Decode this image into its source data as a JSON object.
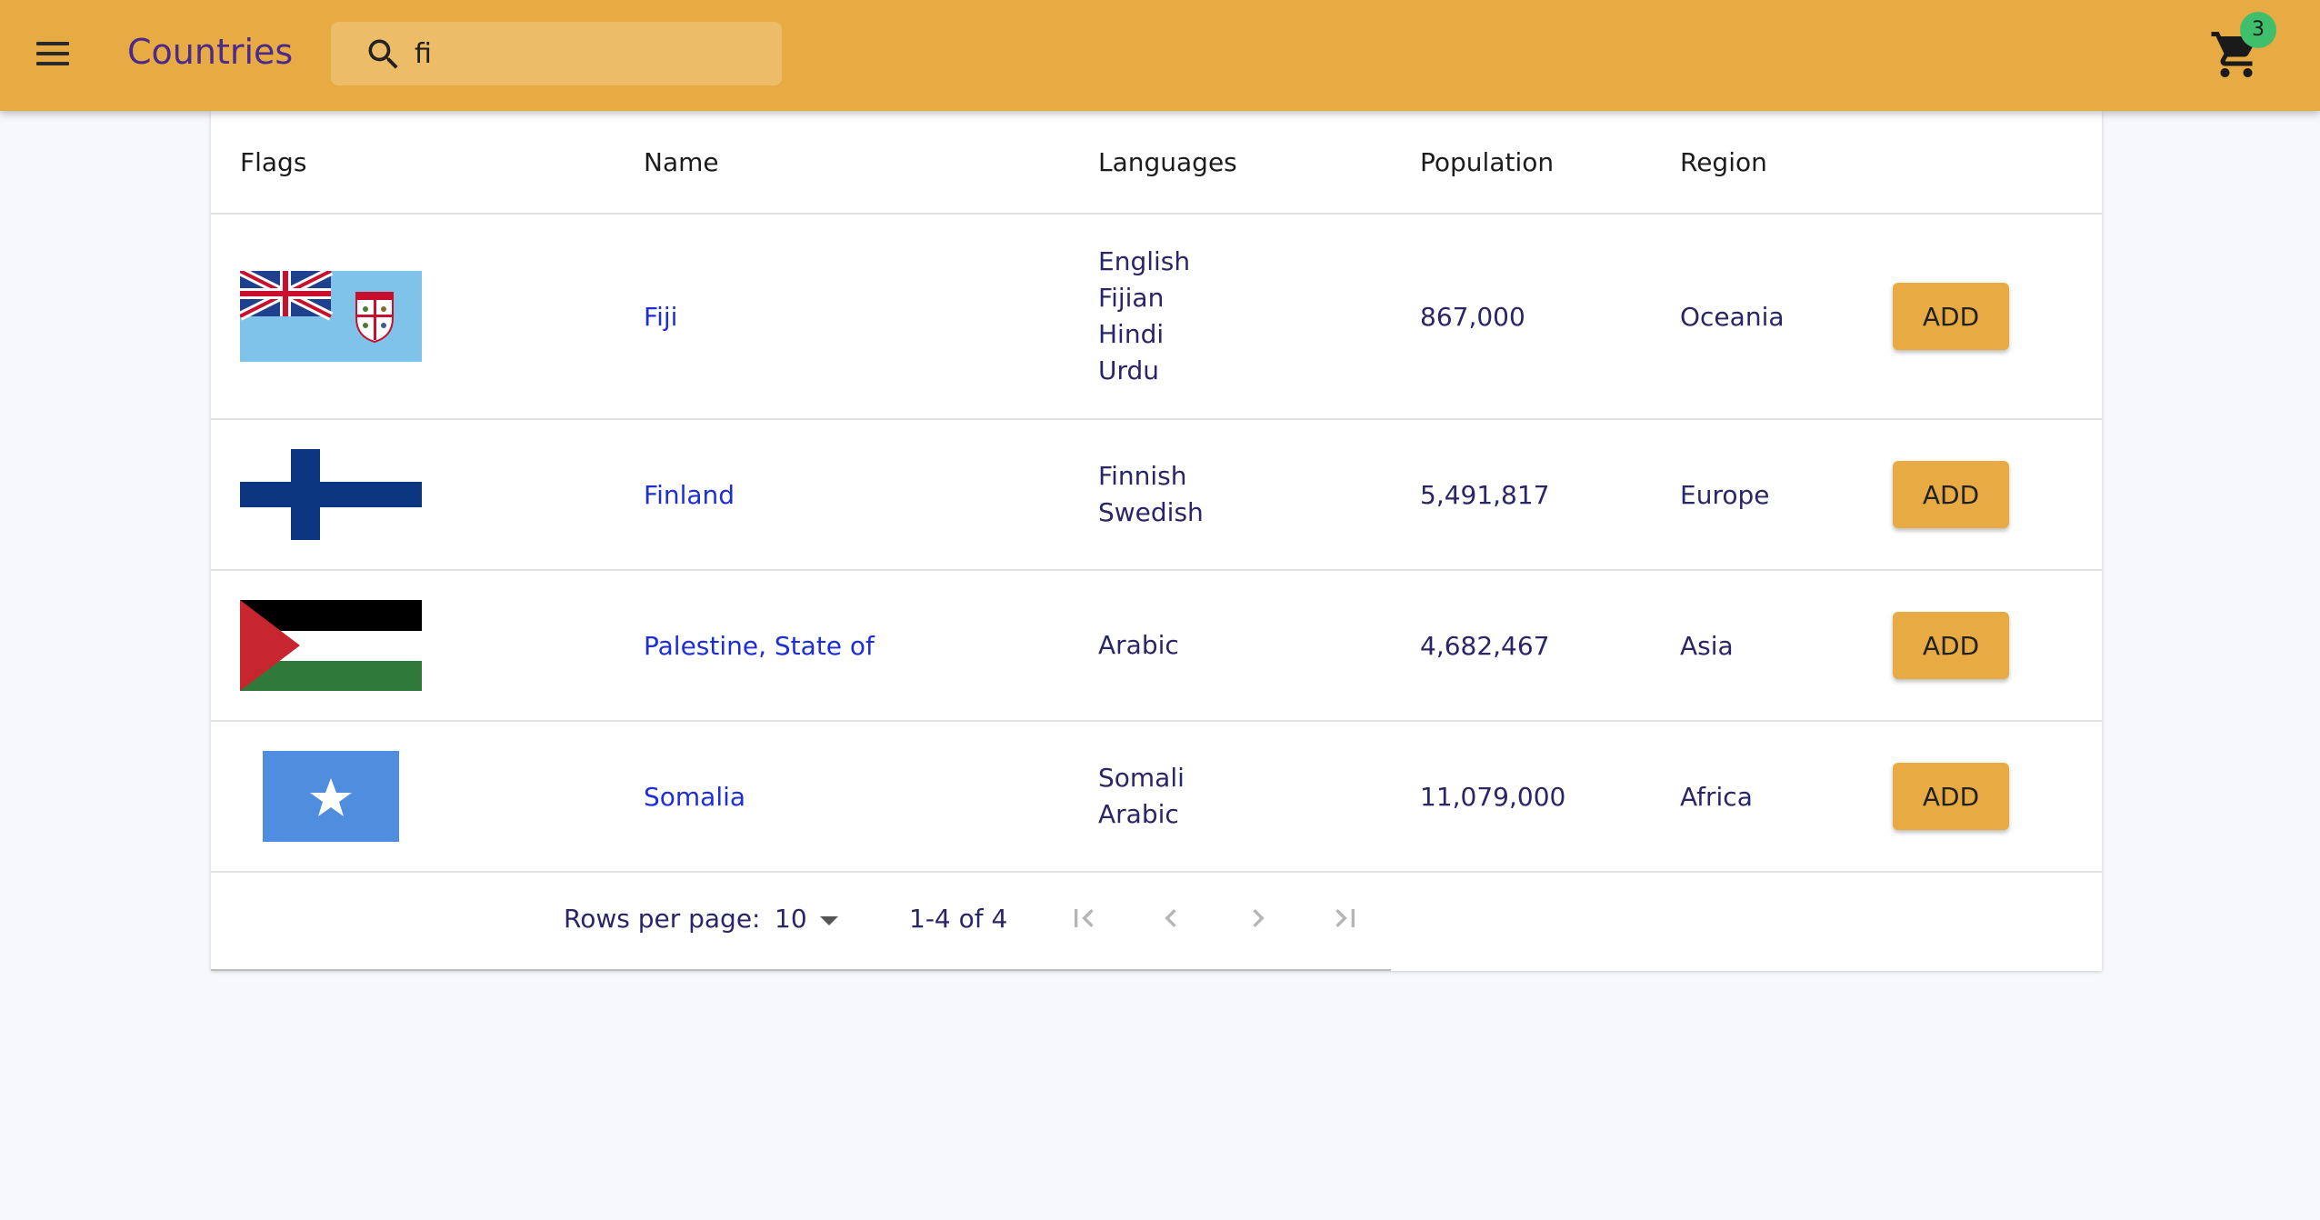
{
  "app": {
    "title": "Countries"
  },
  "search": {
    "value": "fi"
  },
  "cart": {
    "count": "3"
  },
  "table": {
    "headers": [
      "Flags",
      "Name",
      "Languages",
      "Population",
      "Region"
    ],
    "rows": [
      {
        "flag_icon": "fiji-flag-icon",
        "name": "Fiji",
        "languages": [
          "English",
          "Fijian",
          "Hindi",
          "Urdu"
        ],
        "population": "867,000",
        "region": "Oceania",
        "action": "ADD"
      },
      {
        "flag_icon": "finland-flag-icon",
        "name": "Finland",
        "languages": [
          "Finnish",
          "Swedish"
        ],
        "population": "5,491,817",
        "region": "Europe",
        "action": "ADD"
      },
      {
        "flag_icon": "palestine-flag-icon",
        "name": "Palestine, State of",
        "languages": [
          "Arabic"
        ],
        "population": "4,682,467",
        "region": "Asia",
        "action": "ADD"
      },
      {
        "flag_icon": "somalia-flag-icon",
        "name": "Somalia",
        "languages": [
          "Somali",
          "Arabic"
        ],
        "population": "11,079,000",
        "region": "Africa",
        "action": "ADD"
      }
    ]
  },
  "pagination": {
    "rows_per_page_label": "Rows per page:",
    "rows_per_page_value": "10",
    "range": "1-4 of 4"
  },
  "colors": {
    "appbar": "#e8ab44",
    "link": "#1e2ed6",
    "badge": "#3fbf6b",
    "title": "#4b2a8a"
  }
}
